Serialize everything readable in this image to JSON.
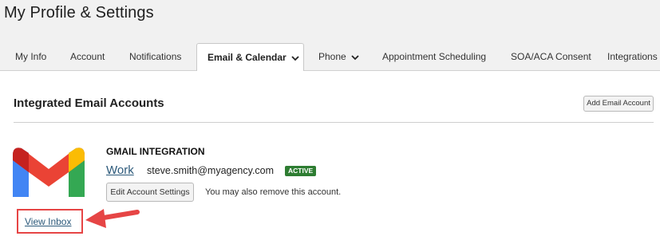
{
  "page": {
    "title": "My Profile & Settings"
  },
  "tabs": [
    {
      "label": "My Info"
    },
    {
      "label": "Account"
    },
    {
      "label": "Notifications"
    },
    {
      "label": "Email & Calendar",
      "active": true,
      "has_dropdown": true
    },
    {
      "label": "Phone",
      "has_dropdown": true
    },
    {
      "label": "Appointment Scheduling"
    },
    {
      "label": "SOA/ACA Consent"
    },
    {
      "label": "Integrations"
    }
  ],
  "section": {
    "title": "Integrated Email Accounts",
    "add_button_label": "Add Email Account"
  },
  "integration": {
    "logo": "gmail-logo",
    "name": "GMAIL INTEGRATION",
    "account_type": "Work",
    "email": "steve.smith@myagency.com",
    "status": "ACTIVE",
    "edit_button_label": "Edit Account Settings",
    "remove_note": "You may also remove this account.",
    "view_inbox_label": "View Inbox"
  },
  "colors": {
    "background": "#f1f1f1",
    "panel": "#ffffff",
    "link": "#2d5a7b",
    "status_active": "#2e7d32",
    "highlight": "#e64545"
  }
}
